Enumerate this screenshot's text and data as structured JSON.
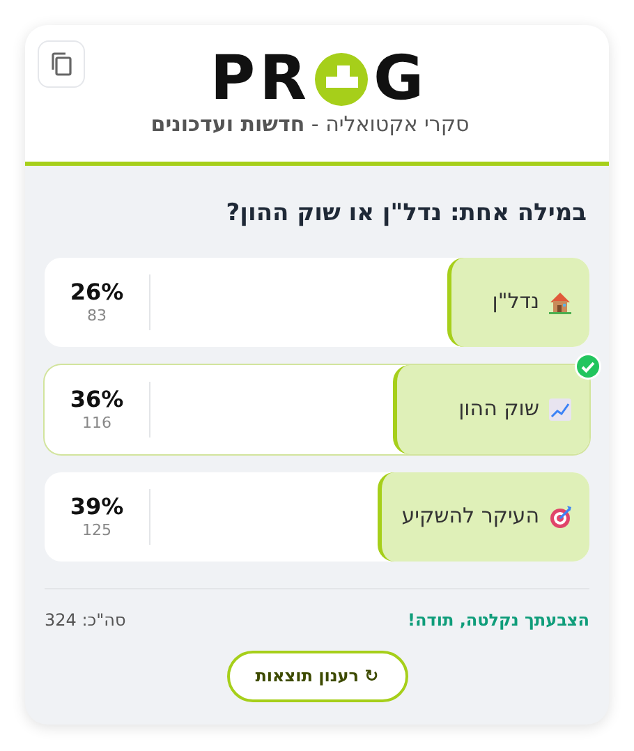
{
  "logo": {
    "text_before": "PR",
    "text_after": "G"
  },
  "subtitle": "סקרי אקטואליה - **חדשות ועדכונים**",
  "question": "במילה אחת: נדל\"ן או שוק ההון?",
  "options": [
    {
      "kind": "house",
      "label": "נדל\"ן",
      "percent": "26%",
      "votes": "83",
      "level": 0.26,
      "selected": false
    },
    {
      "kind": "chart",
      "label": "שוק ההון",
      "percent": "36%",
      "votes": "116",
      "level": 0.36,
      "selected": true
    },
    {
      "kind": "target",
      "label": "העיקר להשקיע",
      "percent": "39%",
      "votes": "125",
      "level": 0.39,
      "selected": false
    }
  ],
  "status": "הצבעתך נקלטה, תודה!",
  "total": "סה\"כ: 324",
  "refresh_button": "↻ רענון תוצאות"
}
